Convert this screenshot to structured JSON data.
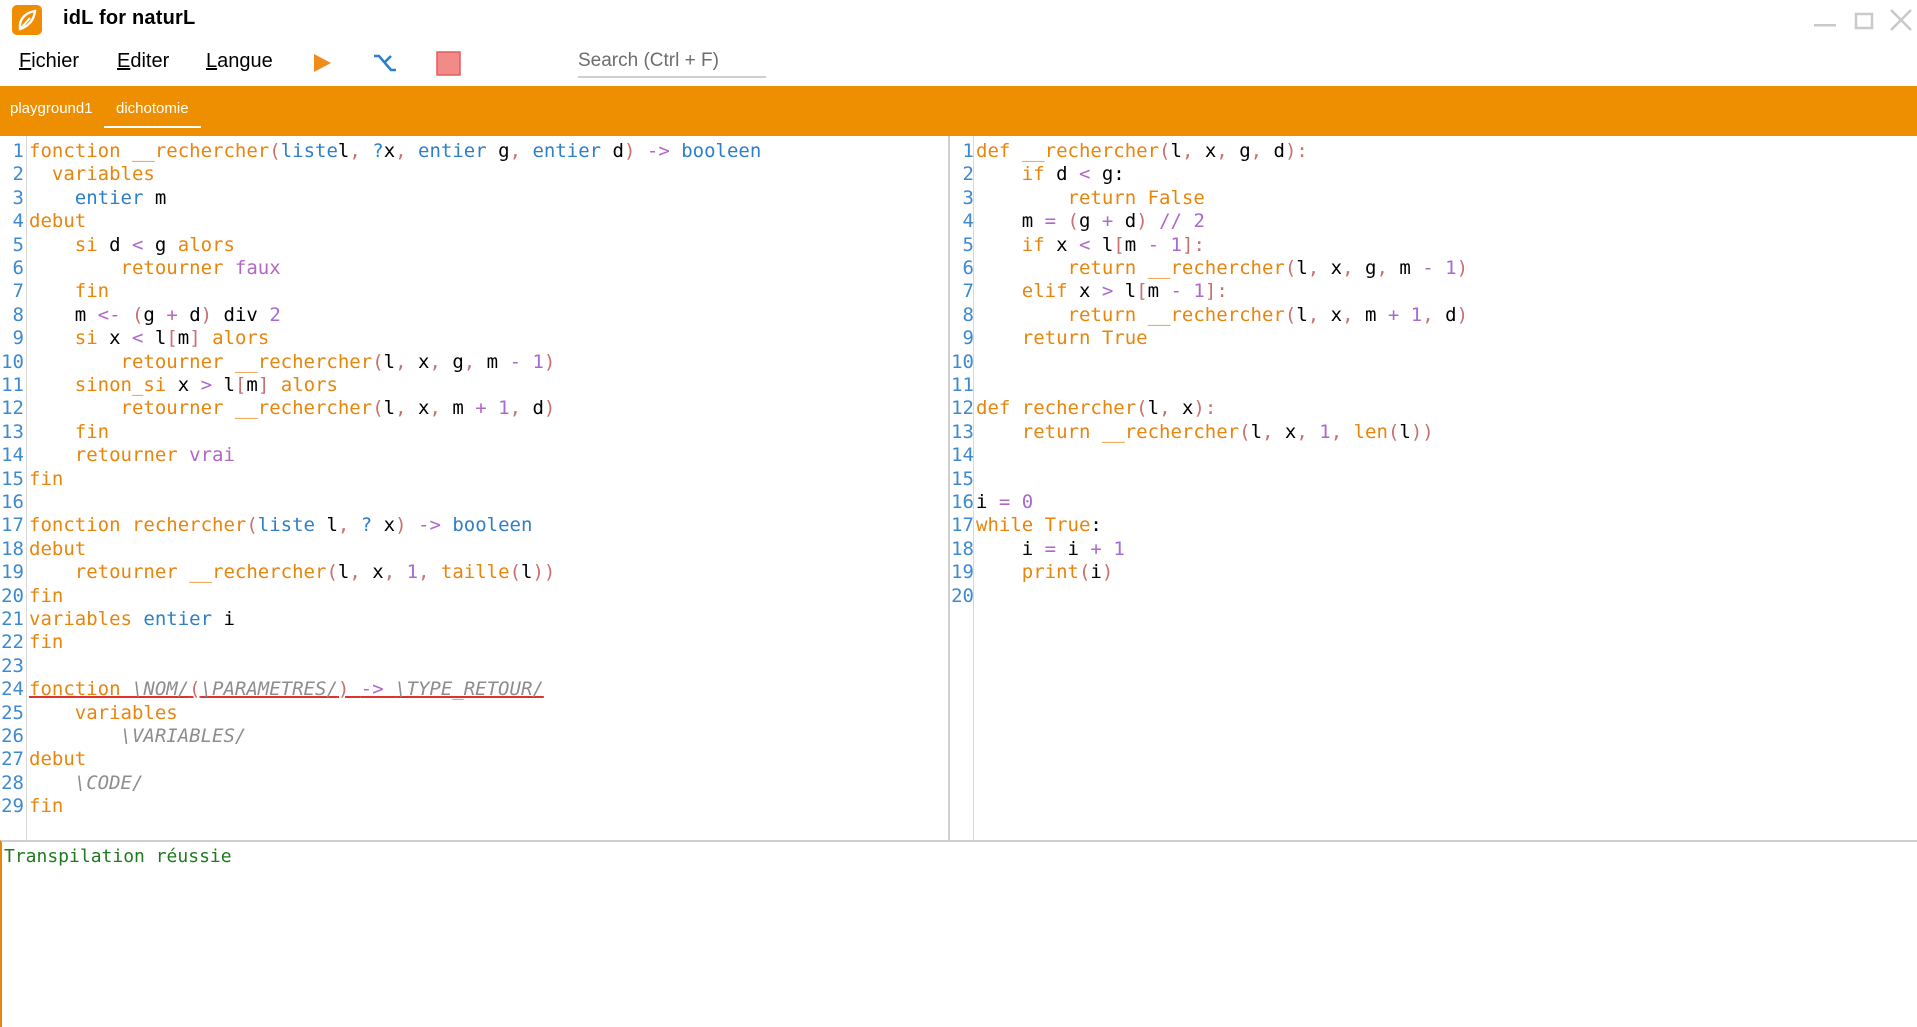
{
  "window": {
    "title": "idL for naturL",
    "controls": {
      "minimize_icon": "minimize-icon",
      "maximize_icon": "maximize-icon",
      "close_icon": "close-icon"
    }
  },
  "menu": {
    "fichier": {
      "first": "F",
      "rest": "ichier"
    },
    "editer": {
      "first": "E",
      "rest": "diter"
    },
    "langue": {
      "first": "L",
      "rest": "angue"
    }
  },
  "toolbar": {
    "run_icon": "play-icon",
    "transpile_icon": "transpile-icon",
    "stop_icon": "stop-icon",
    "search_placeholder": "Search (Ctrl + F)",
    "search_value": ""
  },
  "tabs": [
    {
      "label": "playground1",
      "active": false
    },
    {
      "label": "dichotomie",
      "active": true
    }
  ],
  "colors": {
    "accent": "#ed8f00",
    "keyword": "#e8850c",
    "type": "#2e7fc8",
    "number": "#a86ad0",
    "line_number": "#3d8ad1",
    "success": "#1e7a1e"
  },
  "editor_left": {
    "language": "naturL",
    "lines": [
      [
        [
          "kw",
          "fonction "
        ],
        [
          "fn",
          "__rechercher"
        ],
        [
          "pu",
          "("
        ],
        [
          "ty",
          "liste"
        ],
        [
          "",
          "l"
        ],
        [
          "pu",
          ", "
        ],
        [
          "ty",
          "?"
        ],
        [
          "",
          "x"
        ],
        [
          "pu",
          ", "
        ],
        [
          "ty",
          "entier "
        ],
        [
          "",
          "g"
        ],
        [
          "pu",
          ", "
        ],
        [
          "ty",
          "entier "
        ],
        [
          "",
          "d"
        ],
        [
          "pu",
          ") "
        ],
        [
          "op",
          "-> "
        ],
        [
          "ty",
          "booleen"
        ]
      ],
      [
        [
          "kw",
          "  variables"
        ]
      ],
      [
        [
          "ty",
          "    entier "
        ],
        [
          "",
          "m"
        ]
      ],
      [
        [
          "kw",
          "debut"
        ]
      ],
      [
        [
          "kw",
          "    si "
        ],
        [
          "",
          "d "
        ],
        [
          "op",
          "< "
        ],
        [
          "",
          "g "
        ],
        [
          "kw",
          "alors"
        ]
      ],
      [
        [
          "kw",
          "        retourner "
        ],
        [
          "va",
          "faux"
        ]
      ],
      [
        [
          "kw",
          "    fin"
        ]
      ],
      [
        [
          "",
          "    m "
        ],
        [
          "op",
          "<- "
        ],
        [
          "pu",
          "("
        ],
        [
          "",
          "g "
        ],
        [
          "op",
          "+ "
        ],
        [
          "",
          "d"
        ],
        [
          "pu",
          ")"
        ],
        [
          "",
          " div "
        ],
        [
          "num",
          "2"
        ]
      ],
      [
        [
          "kw",
          "    si "
        ],
        [
          "",
          "x "
        ],
        [
          "op",
          "< "
        ],
        [
          "",
          "l"
        ],
        [
          "pu",
          "["
        ],
        [
          "",
          "m"
        ],
        [
          "pu",
          "] "
        ],
        [
          "kw",
          "alors"
        ]
      ],
      [
        [
          "kw",
          "        retourner "
        ],
        [
          "fn",
          "__rechercher"
        ],
        [
          "pu",
          "("
        ],
        [
          "",
          "l"
        ],
        [
          "pu",
          ", "
        ],
        [
          "",
          "x"
        ],
        [
          "pu",
          ", "
        ],
        [
          "",
          "g"
        ],
        [
          "pu",
          ", "
        ],
        [
          "",
          "m "
        ],
        [
          "op",
          "- "
        ],
        [
          "num",
          "1"
        ],
        [
          "pu",
          ")"
        ]
      ],
      [
        [
          "kw",
          "    sinon_si "
        ],
        [
          "",
          "x "
        ],
        [
          "op",
          "> "
        ],
        [
          "",
          "l"
        ],
        [
          "pu",
          "["
        ],
        [
          "",
          "m"
        ],
        [
          "pu",
          "] "
        ],
        [
          "kw",
          "alors"
        ]
      ],
      [
        [
          "kw",
          "        retourner "
        ],
        [
          "fn",
          "__rechercher"
        ],
        [
          "pu",
          "("
        ],
        [
          "",
          "l"
        ],
        [
          "pu",
          ", "
        ],
        [
          "",
          "x"
        ],
        [
          "pu",
          ", "
        ],
        [
          "",
          "m "
        ],
        [
          "op",
          "+ "
        ],
        [
          "num",
          "1"
        ],
        [
          "pu",
          ", "
        ],
        [
          "",
          "d"
        ],
        [
          "pu",
          ")"
        ]
      ],
      [
        [
          "kw",
          "    fin"
        ]
      ],
      [
        [
          "kw",
          "    retourner "
        ],
        [
          "va",
          "vrai"
        ]
      ],
      [
        [
          "kw",
          "fin"
        ]
      ],
      [],
      [
        [
          "kw",
          "fonction "
        ],
        [
          "fn",
          "rechercher"
        ],
        [
          "pu",
          "("
        ],
        [
          "ty",
          "liste "
        ],
        [
          "",
          "l"
        ],
        [
          "pu",
          ", "
        ],
        [
          "ty",
          "? "
        ],
        [
          "",
          "x"
        ],
        [
          "pu",
          ") "
        ],
        [
          "op",
          "-> "
        ],
        [
          "ty",
          "booleen"
        ]
      ],
      [
        [
          "kw",
          "debut"
        ]
      ],
      [
        [
          "kw",
          "    retourner "
        ],
        [
          "fn",
          "__rechercher"
        ],
        [
          "pu",
          "("
        ],
        [
          "",
          "l"
        ],
        [
          "pu",
          ", "
        ],
        [
          "",
          "x"
        ],
        [
          "pu",
          ", "
        ],
        [
          "num",
          "1"
        ],
        [
          "pu",
          ", "
        ],
        [
          "fn",
          "taille"
        ],
        [
          "pu",
          "("
        ],
        [
          "",
          "l"
        ],
        [
          "pu",
          "))"
        ]
      ],
      [
        [
          "kw",
          "fin"
        ]
      ],
      [
        [
          "kw",
          "variables "
        ],
        [
          "ty",
          "entier "
        ],
        [
          "",
          "i"
        ]
      ],
      [
        [
          "kw",
          "fin"
        ]
      ],
      [],
      [
        [
          "kw err",
          "fonction "
        ],
        [
          "ph err",
          "\\NOM/"
        ],
        [
          "pu err",
          "("
        ],
        [
          "ph err",
          "\\PARAMETRES/"
        ],
        [
          "pu err",
          ") "
        ],
        [
          "op err",
          "-> "
        ],
        [
          "ph err",
          "\\TYPE_RETOUR/"
        ]
      ],
      [
        [
          "kw",
          "    variables"
        ]
      ],
      [
        [
          "ph",
          "        \\VARIABLES/"
        ]
      ],
      [
        [
          "kw",
          "debut"
        ]
      ],
      [
        [
          "ph",
          "    \\CODE/"
        ]
      ],
      [
        [
          "kw",
          "fin"
        ]
      ]
    ]
  },
  "editor_right": {
    "language": "python",
    "lines": [
      [
        [
          "kw",
          "def "
        ],
        [
          "fn",
          "__rechercher"
        ],
        [
          "pu",
          "("
        ],
        [
          "",
          "l"
        ],
        [
          "pu",
          ", "
        ],
        [
          "",
          "x"
        ],
        [
          "pu",
          ", "
        ],
        [
          "",
          "g"
        ],
        [
          "pu",
          ", "
        ],
        [
          "",
          "d"
        ],
        [
          "pu",
          "):"
        ]
      ],
      [
        [
          "kw",
          "    if "
        ],
        [
          "",
          "d "
        ],
        [
          "op",
          "< "
        ],
        [
          "",
          "g:"
        ]
      ],
      [
        [
          "kw",
          "        return "
        ],
        [
          "kw",
          "False"
        ]
      ],
      [
        [
          "",
          "    m "
        ],
        [
          "op",
          "= "
        ],
        [
          "pu",
          "("
        ],
        [
          "",
          "g "
        ],
        [
          "op",
          "+ "
        ],
        [
          "",
          "d"
        ],
        [
          "pu",
          ") "
        ],
        [
          "op",
          "// "
        ],
        [
          "num",
          "2"
        ]
      ],
      [
        [
          "kw",
          "    if "
        ],
        [
          "",
          "x "
        ],
        [
          "op",
          "< "
        ],
        [
          "",
          "l"
        ],
        [
          "pu",
          "["
        ],
        [
          "",
          "m "
        ],
        [
          "op",
          "- "
        ],
        [
          "num",
          "1"
        ],
        [
          "pu",
          "]:"
        ]
      ],
      [
        [
          "kw",
          "        return "
        ],
        [
          "fn",
          "__rechercher"
        ],
        [
          "pu",
          "("
        ],
        [
          "",
          "l"
        ],
        [
          "pu",
          ", "
        ],
        [
          "",
          "x"
        ],
        [
          "pu",
          ", "
        ],
        [
          "",
          "g"
        ],
        [
          "pu",
          ", "
        ],
        [
          "",
          "m "
        ],
        [
          "op",
          "- "
        ],
        [
          "num",
          "1"
        ],
        [
          "pu",
          ")"
        ]
      ],
      [
        [
          "kw",
          "    elif "
        ],
        [
          "",
          "x "
        ],
        [
          "op",
          "> "
        ],
        [
          "",
          "l"
        ],
        [
          "pu",
          "["
        ],
        [
          "",
          "m "
        ],
        [
          "op",
          "- "
        ],
        [
          "num",
          "1"
        ],
        [
          "pu",
          "]:"
        ]
      ],
      [
        [
          "kw",
          "        return "
        ],
        [
          "fn",
          "__rechercher"
        ],
        [
          "pu",
          "("
        ],
        [
          "",
          "l"
        ],
        [
          "pu",
          ", "
        ],
        [
          "",
          "x"
        ],
        [
          "pu",
          ", "
        ],
        [
          "",
          "m "
        ],
        [
          "op",
          "+ "
        ],
        [
          "num",
          "1"
        ],
        [
          "pu",
          ", "
        ],
        [
          "",
          "d"
        ],
        [
          "pu",
          ")"
        ]
      ],
      [
        [
          "kw",
          "    return "
        ],
        [
          "kw",
          "True"
        ]
      ],
      [],
      [],
      [
        [
          "kw",
          "def "
        ],
        [
          "fn",
          "rechercher"
        ],
        [
          "pu",
          "("
        ],
        [
          "",
          "l"
        ],
        [
          "pu",
          ", "
        ],
        [
          "",
          "x"
        ],
        [
          "pu",
          "):"
        ]
      ],
      [
        [
          "kw",
          "    return "
        ],
        [
          "fn",
          "__rechercher"
        ],
        [
          "pu",
          "("
        ],
        [
          "",
          "l"
        ],
        [
          "pu",
          ", "
        ],
        [
          "",
          "x"
        ],
        [
          "pu",
          ", "
        ],
        [
          "num",
          "1"
        ],
        [
          "pu",
          ", "
        ],
        [
          "fn",
          "len"
        ],
        [
          "pu",
          "("
        ],
        [
          "",
          "l"
        ],
        [
          "pu",
          "))"
        ]
      ],
      [],
      [],
      [
        [
          "",
          "i "
        ],
        [
          "op",
          "= "
        ],
        [
          "num",
          "0"
        ]
      ],
      [
        [
          "kw",
          "while "
        ],
        [
          "kw",
          "True"
        ],
        [
          "",
          ":"
        ]
      ],
      [
        [
          "",
          "    i "
        ],
        [
          "op",
          "= "
        ],
        [
          "",
          "i "
        ],
        [
          "op",
          "+ "
        ],
        [
          "num",
          "1"
        ]
      ],
      [
        [
          "fn",
          "    print"
        ],
        [
          "pu",
          "("
        ],
        [
          "",
          "i"
        ],
        [
          "pu",
          ")"
        ]
      ],
      []
    ]
  },
  "console": {
    "message": "Transpilation réussie"
  }
}
